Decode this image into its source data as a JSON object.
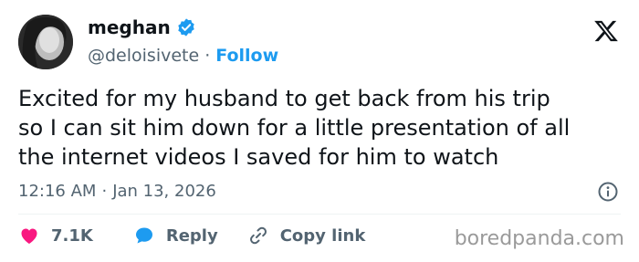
{
  "author": {
    "name": "meghan",
    "handle": "@deloisivete",
    "separator": "·",
    "follow_label": "Follow"
  },
  "tweet": {
    "text": "Excited for my husband to get back from his trip\nso I can sit him down for a little presentation of all\nthe internet videos I saved for him to watch",
    "time": "12:16 AM",
    "meta_separator": "·",
    "date": "Jan 13, 2026"
  },
  "actions": {
    "like_count": "7.1K",
    "reply_label": "Reply",
    "copy_label": "Copy link"
  },
  "watermark": "boredpanda.com",
  "colors": {
    "accent": "#1d9bf0",
    "like": "#f91880",
    "text": "#0f1419",
    "muted": "#536471"
  },
  "icons": [
    "avatar-photo",
    "verified-badge-icon",
    "x-logo-icon",
    "info-icon",
    "heart-icon",
    "reply-bubble-icon",
    "link-icon"
  ]
}
